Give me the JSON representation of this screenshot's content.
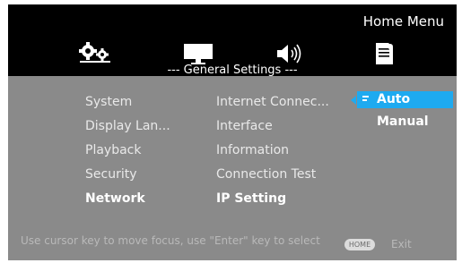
{
  "header": {
    "menu_title": "Home Menu",
    "tabs": [
      {
        "icon": "settings-gears-icon",
        "selected": true
      },
      {
        "icon": "display-monitor-icon",
        "selected": false
      },
      {
        "icon": "speaker-audio-icon",
        "selected": false
      },
      {
        "icon": "document-icon",
        "selected": false
      }
    ]
  },
  "section_title": "--- General Settings ---",
  "categories": [
    "System",
    "Display Lan...",
    "Playback",
    "Security",
    "Network"
  ],
  "active_category": "Network",
  "network_items": [
    "Internet Connec...",
    "Interface",
    "Information",
    "Connection Test",
    "IP Setting"
  ],
  "options": [
    "Auto",
    "Manual"
  ],
  "selected_option": "Auto",
  "footer": {
    "hint": "Use cursor key to move focus, use \"Enter\" key to select",
    "home_badge": "HOME",
    "exit_label": "Exit"
  },
  "colors": {
    "highlight": "#1eaaf0",
    "panel": "#8a8a8a",
    "header": "#000000"
  }
}
